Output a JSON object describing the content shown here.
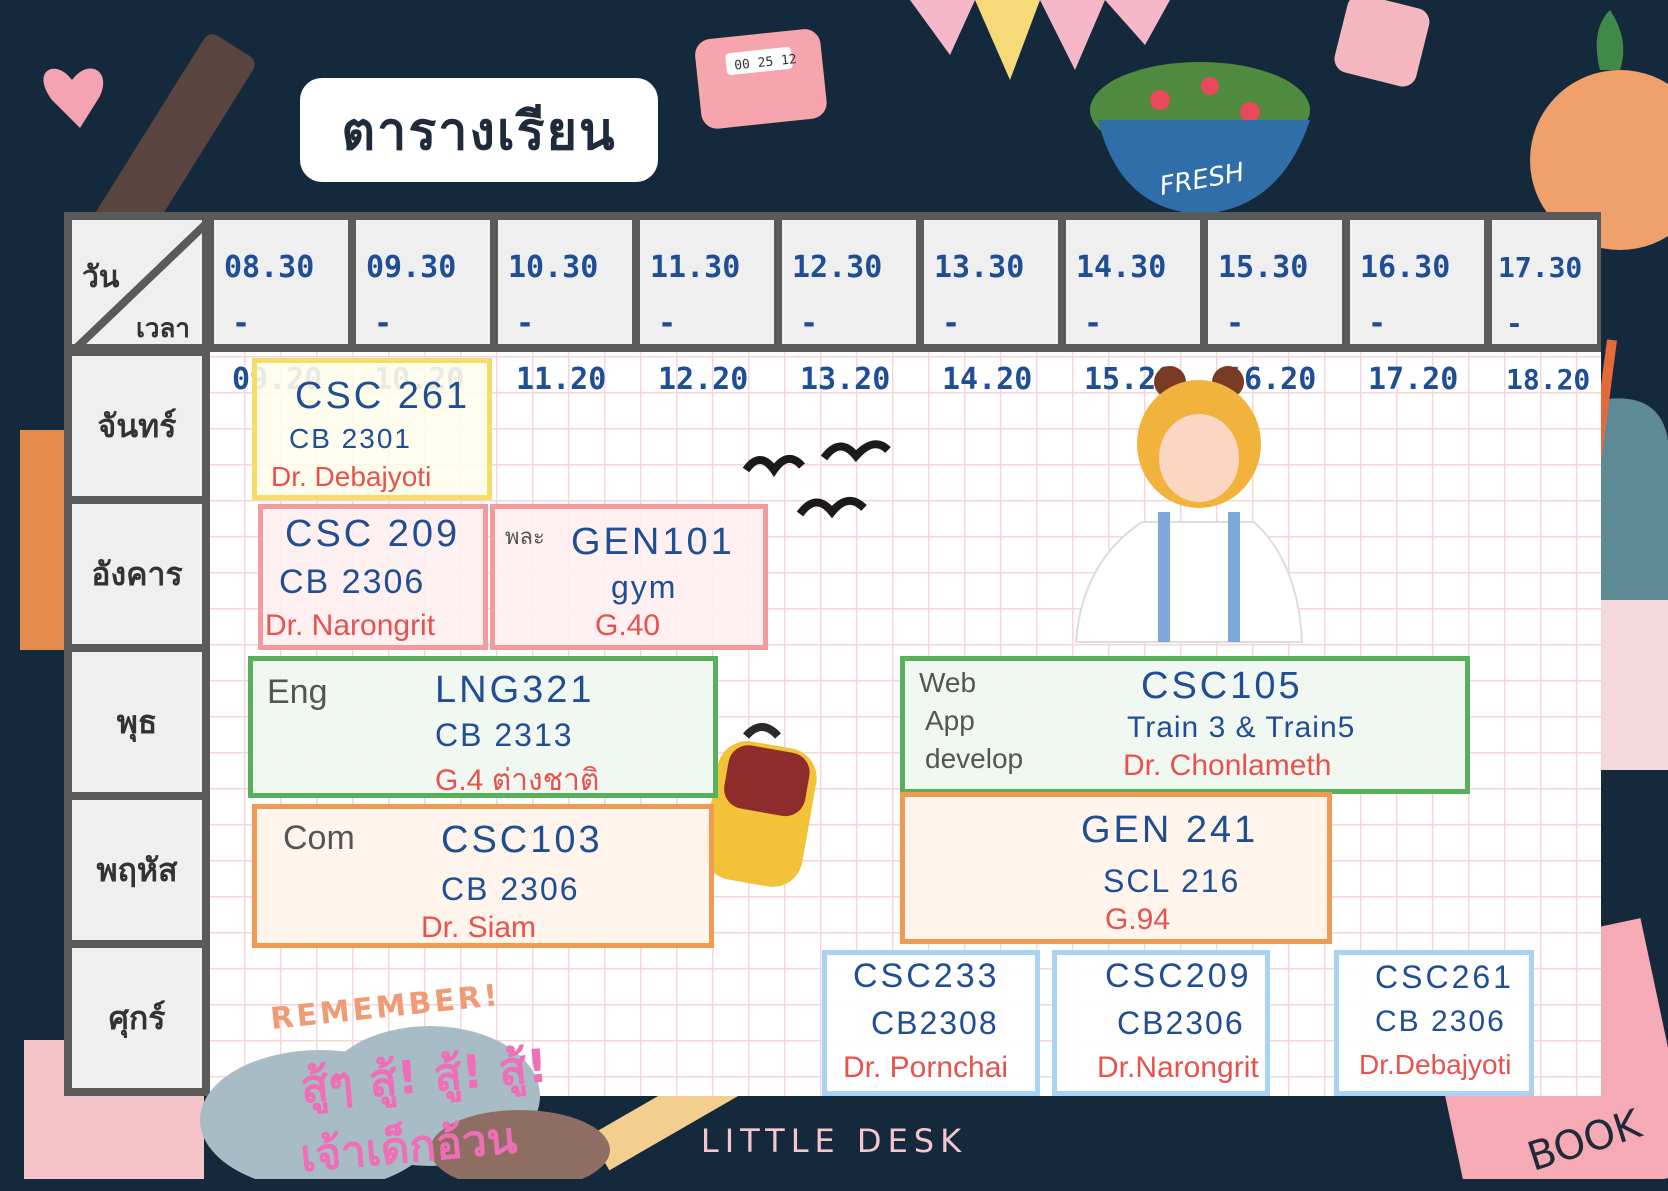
{
  "title": "ตารางเรียน",
  "corner": {
    "day_label": "วัน",
    "time_label": "เวลา"
  },
  "time_slots": [
    {
      "start": "08.30",
      "end": "- 09.20"
    },
    {
      "start": "09.30",
      "end": "- 10.20"
    },
    {
      "start": "10.30",
      "end": "- 11.20"
    },
    {
      "start": "11.30",
      "end": "- 12.20"
    },
    {
      "start": "12.30",
      "end": "- 13.20"
    },
    {
      "start": "13.30",
      "end": "- 14.20"
    },
    {
      "start": "14.30",
      "end": "- 15.20"
    },
    {
      "start": "15.30",
      "end": "- 16.20"
    },
    {
      "start": "16.30",
      "end": "- 17.20"
    },
    {
      "start": "17.30",
      "end": "- 18.20"
    }
  ],
  "days": [
    "จันทร์",
    "อังคาร",
    "พุธ",
    "พฤหัส",
    "ศุกร์"
  ],
  "courses": {
    "mon_csc261": {
      "code": "CSC 261",
      "room": "CB 2301",
      "prof": "Dr. Debajyoti"
    },
    "tue_csc209": {
      "code": "CSC 209",
      "room": "CB 2306",
      "prof": "Dr. Narongrit"
    },
    "tue_gen101": {
      "note": "พละ",
      "code": "GEN101",
      "room": "gym",
      "prof": "G.40"
    },
    "wed_lng321": {
      "note": "Eng",
      "code": "LNG321",
      "room": "CB 2313",
      "prof": "G.4 ต่างชาติ"
    },
    "wed_csc105": {
      "note1": "Web",
      "note2": "App",
      "note3": "develop",
      "code": "CSC105",
      "room": "Train 3 & Train5",
      "prof": "Dr. Chonlameth"
    },
    "thu_csc103": {
      "note": "Com",
      "code": "CSC103",
      "room": "CB 2306",
      "prof": "Dr. Siam"
    },
    "thu_gen241": {
      "code": "GEN 241",
      "room": "SCL 216",
      "prof": "G.94"
    },
    "fri_csc233": {
      "code": "CSC233",
      "room": "CB2308",
      "prof": "Dr. Pornchai"
    },
    "fri_csc209": {
      "code": "CSC209",
      "room": "CB2306",
      "prof": "Dr.Narongrit"
    },
    "fri_csc261": {
      "code": "CSC261",
      "room": "CB 2306",
      "prof": "Dr.Debajyoti"
    }
  },
  "decor": {
    "remember": "REMEMBER!",
    "cheer1": "สู้ๆ สู้! สู้! สู้!",
    "cheer2": "เจ้าเด็กอ้วน",
    "fresh": "FRESH",
    "timer": "00 25 12",
    "book": "BOOK"
  },
  "footer": "LITTLE DESK",
  "colors": {
    "background": "#142a3c",
    "code_blue": "#1f4e94",
    "prof_red": "#e8524e",
    "yellow": "#f6dc6a",
    "pink": "#f29a9e",
    "green": "#58b05a",
    "orange": "#f09b53",
    "light_blue": "#a9d3f5"
  }
}
